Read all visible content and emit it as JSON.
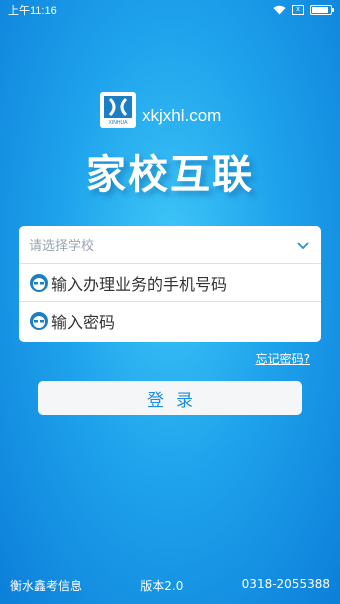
{
  "status_bar": {
    "time": "上午11:16",
    "sim_label": "x"
  },
  "logo": {
    "domain": "xkjxhl.com",
    "mark_caption": "XINHUA"
  },
  "app_title": "家校互联",
  "form": {
    "school_placeholder": "请选择学校",
    "phone_label": "输入办理业务的手机号码",
    "password_label": "输入密码"
  },
  "forgot_password": "忘记密码?",
  "login_label": "登录",
  "footer": {
    "company": "衡水鑫考信息",
    "version": "版本2.0",
    "phone": "0318-2055388"
  },
  "colors": {
    "background": "#1fa3ec",
    "button_text": "#1d8ee0",
    "icon_accent": "#1b7fc4"
  }
}
